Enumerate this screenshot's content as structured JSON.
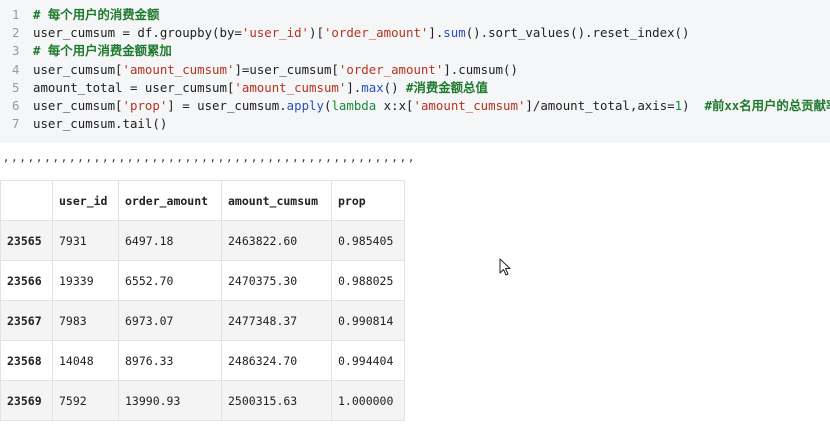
{
  "code": {
    "lines": [
      {
        "num": "1",
        "parts": [
          {
            "c": "cm",
            "t": "# 每个用户的消费金额"
          }
        ]
      },
      {
        "num": "2",
        "parts": [
          {
            "c": "",
            "t": "user_cumsum = df.groupby(by="
          },
          {
            "c": "st",
            "t": "'user_id'"
          },
          {
            "c": "",
            "t": ")["
          },
          {
            "c": "st",
            "t": "'order_amount'"
          },
          {
            "c": "",
            "t": "]."
          },
          {
            "c": "fn",
            "t": "sum"
          },
          {
            "c": "",
            "t": "().sort_values().reset_index()"
          }
        ]
      },
      {
        "num": "3",
        "parts": [
          {
            "c": "cm",
            "t": "# 每个用户消费金额累加"
          }
        ]
      },
      {
        "num": "4",
        "parts": [
          {
            "c": "",
            "t": "user_cumsum["
          },
          {
            "c": "st",
            "t": "'amount_cumsum'"
          },
          {
            "c": "",
            "t": "]=user_cumsum["
          },
          {
            "c": "st",
            "t": "'order_amount'"
          },
          {
            "c": "",
            "t": "].cumsum()"
          }
        ]
      },
      {
        "num": "5",
        "parts": [
          {
            "c": "",
            "t": "amount_total = user_cumsum["
          },
          {
            "c": "st",
            "t": "'amount_cumsum'"
          },
          {
            "c": "",
            "t": "]."
          },
          {
            "c": "fn",
            "t": "max"
          },
          {
            "c": "",
            "t": "() "
          },
          {
            "c": "cm",
            "t": "#消费金额总值"
          }
        ]
      },
      {
        "num": "6",
        "parts": [
          {
            "c": "",
            "t": "user_cumsum["
          },
          {
            "c": "st",
            "t": "'prop'"
          },
          {
            "c": "",
            "t": "] = user_cumsum."
          },
          {
            "c": "fn",
            "t": "apply"
          },
          {
            "c": "",
            "t": "("
          },
          {
            "c": "kw",
            "t": "lambda"
          },
          {
            "c": "",
            "t": " x:x["
          },
          {
            "c": "st",
            "t": "'amount_cumsum'"
          },
          {
            "c": "",
            "t": "]/amount_total,axis="
          },
          {
            "c": "nb",
            "t": "1"
          },
          {
            "c": "",
            "t": ")  "
          },
          {
            "c": "cm",
            "t": "#前xx名用户的总贡献率"
          }
        ]
      },
      {
        "num": "7",
        "parts": [
          {
            "c": "",
            "t": "user_cumsum.tail()"
          }
        ]
      }
    ]
  },
  "output_dots": ", , , , , , , , , , , , , , , , , , , , , , , , , , , , , , , , , , , , , , , , , , , , , , , , , ,",
  "table": {
    "columns": [
      "",
      "user_id",
      "order_amount",
      "amount_cumsum",
      "prop"
    ],
    "rows": [
      {
        "index": "23565",
        "cells": [
          "7931",
          "6497.18",
          "2463822.60",
          "0.985405"
        ]
      },
      {
        "index": "23566",
        "cells": [
          "19339",
          "6552.70",
          "2470375.30",
          "0.988025"
        ]
      },
      {
        "index": "23567",
        "cells": [
          "7983",
          "6973.07",
          "2477348.37",
          "0.990814"
        ]
      },
      {
        "index": "23568",
        "cells": [
          "14048",
          "8976.33",
          "2486324.70",
          "0.994404"
        ]
      },
      {
        "index": "23569",
        "cells": [
          "7592",
          "13990.93",
          "2500315.63",
          "1.000000"
        ]
      }
    ]
  },
  "cursor_icon": "mouse-pointer-icon"
}
